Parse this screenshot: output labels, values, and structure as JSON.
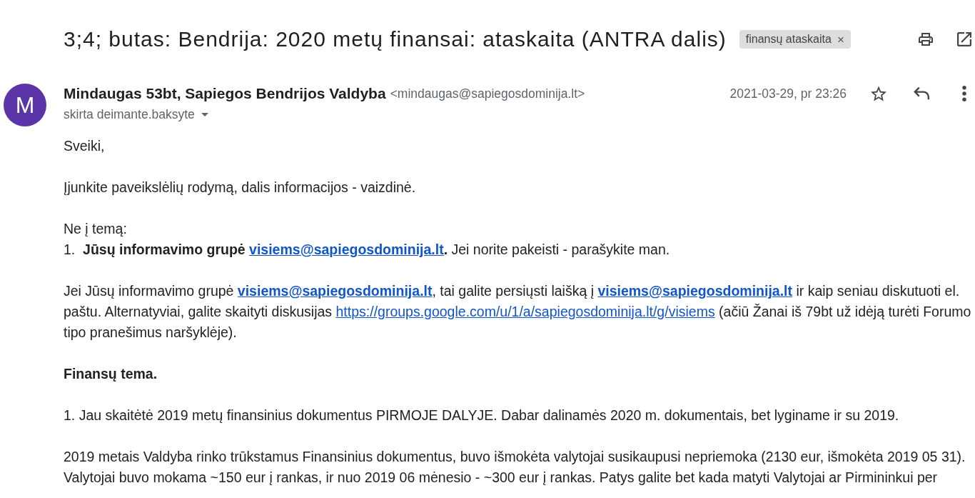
{
  "subject": {
    "title": "3;4; butas: Bendrija: 2020 metų finansai: ataskaita (ANTRA dalis)",
    "labels": [
      {
        "text": "finansų ataskaita",
        "remove": "×"
      }
    ]
  },
  "message": {
    "avatar": "M",
    "sender_name": "Mindaugas 53bt, Sapiegos Bendrijos Valdyba",
    "sender_email": "<mindaugas@sapiegosdominija.lt>",
    "recipients": "skirta deimante.baksyte",
    "date": "2021-03-29, pr 23:26",
    "starred": false,
    "body": [
      {
        "kind": "text",
        "lines": [
          [
            {
              "kind": "text",
              "text": "Sveiki,"
            }
          ]
        ]
      },
      {
        "kind": "text",
        "lines": [
          [
            {
              "kind": "text",
              "text": "Įjunkite paveikslėlių rodymą, dalis informacijos - vaizdinė."
            }
          ]
        ]
      },
      {
        "kind": "text",
        "lines": [
          [
            {
              "kind": "text",
              "text": "Ne į temą:"
            }
          ],
          [
            {
              "kind": "text",
              "text": "1.  **Jūsų informavimo grupė** "
            },
            {
              "kind": "link",
              "text": "visiems@sapiegosdominija.lt",
              "bold": true
            },
            {
              "kind": "text",
              "text": "**.** Jei norite pakeisti - parašykite man."
            }
          ]
        ]
      },
      {
        "kind": "text",
        "lines": [
          [
            {
              "kind": "text",
              "text": "Jei Jūsų informavimo grupė "
            },
            {
              "kind": "link",
              "text": "visiems@sapiegosdominija.lt",
              "bold": true
            },
            {
              "kind": "text",
              "text": ", tai galite persiųsti laišką į "
            },
            {
              "kind": "link",
              "text": "visiems@sapiegosdominija.lt",
              "bold": true
            },
            {
              "kind": "text",
              "text": " ir kaip seniau diskutuoti el. paštu. Alternatyviai, galite skaityti diskusijas "
            },
            {
              "kind": "link",
              "text": "https://groups.google.com/u/1/a/sapiegosdominija.lt/g/visiems",
              "bold": false
            },
            {
              "kind": "text",
              "text": " (ačiū Žanai iš 79bt už idėją turėti Forumo tipo pranešimus naršyklėje)."
            }
          ]
        ]
      },
      {
        "kind": "heading",
        "lines": [
          [
            {
              "kind": "text",
              "text": "Finansų tema."
            }
          ]
        ]
      },
      {
        "kind": "text",
        "lines": [
          [
            {
              "kind": "text",
              "text": "1. Jau skaitėtė 2019 metų finansinius dokumentus PIRMOJE DALYJE. Dabar dalinamės 2020 m. dokumentais, bet lyginame ir su 2019."
            }
          ]
        ]
      },
      {
        "kind": "text",
        "lines": [
          [
            {
              "kind": "text",
              "text": "2019 metais Valdyba rinko trūkstamus Finansinius dokumentus, buvo išmokėta valytojai susikaupusi nepriemoka (2130 eur, išmokėta 2019 05 31). Valytojai buvo mokama ~150 eur į rankas, ir nuo 2019 06 mėnesio - ~300 eur į rankas. Patys galite bet kada matyti Valytojai ar Pirmininkui per"
            }
          ]
        ]
      }
    ]
  }
}
